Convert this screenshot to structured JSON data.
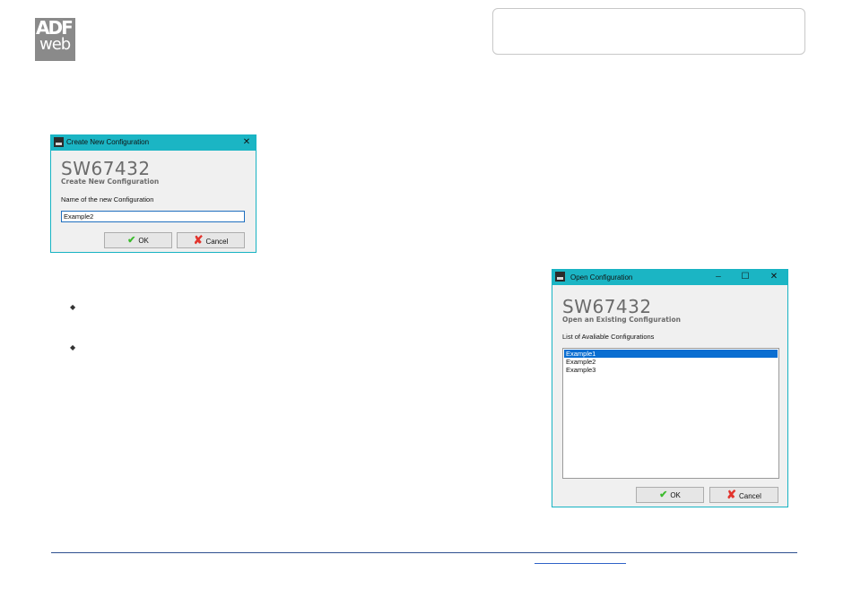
{
  "logo": {
    "top": "ADF",
    "bottom": "web"
  },
  "create_dialog": {
    "title": "Create New Configuration",
    "close_glyph": "✕",
    "product": "SW67432",
    "subtitle": "Create New Configuration",
    "field_label": "Name of the new Configuration",
    "field_value": "Example2",
    "ok_label": "OK",
    "cancel_label": "Cancel"
  },
  "open_dialog": {
    "title": "Open Configuration",
    "minimize_glyph": "─",
    "maximize_glyph": "☐",
    "close_glyph": "✕",
    "product": "SW67432",
    "subtitle": "Open an Existing Configuration",
    "list_label": "List of Avaliable Configurations",
    "items": [
      "Example1",
      "Example2",
      "Example3"
    ],
    "selected_item": "Example1",
    "ok_label": "OK",
    "cancel_label": "Cancel"
  },
  "bullets": [
    "◆",
    "◆"
  ],
  "icons": {
    "ok": "check-icon",
    "cancel": "cross-icon",
    "app": "adfweb-app-icon"
  },
  "colors": {
    "titlebar": "#1bb5c4",
    "selection": "#0a6ed1",
    "logo": "#8a8a8a",
    "footer_line": "#2e4f8f"
  }
}
